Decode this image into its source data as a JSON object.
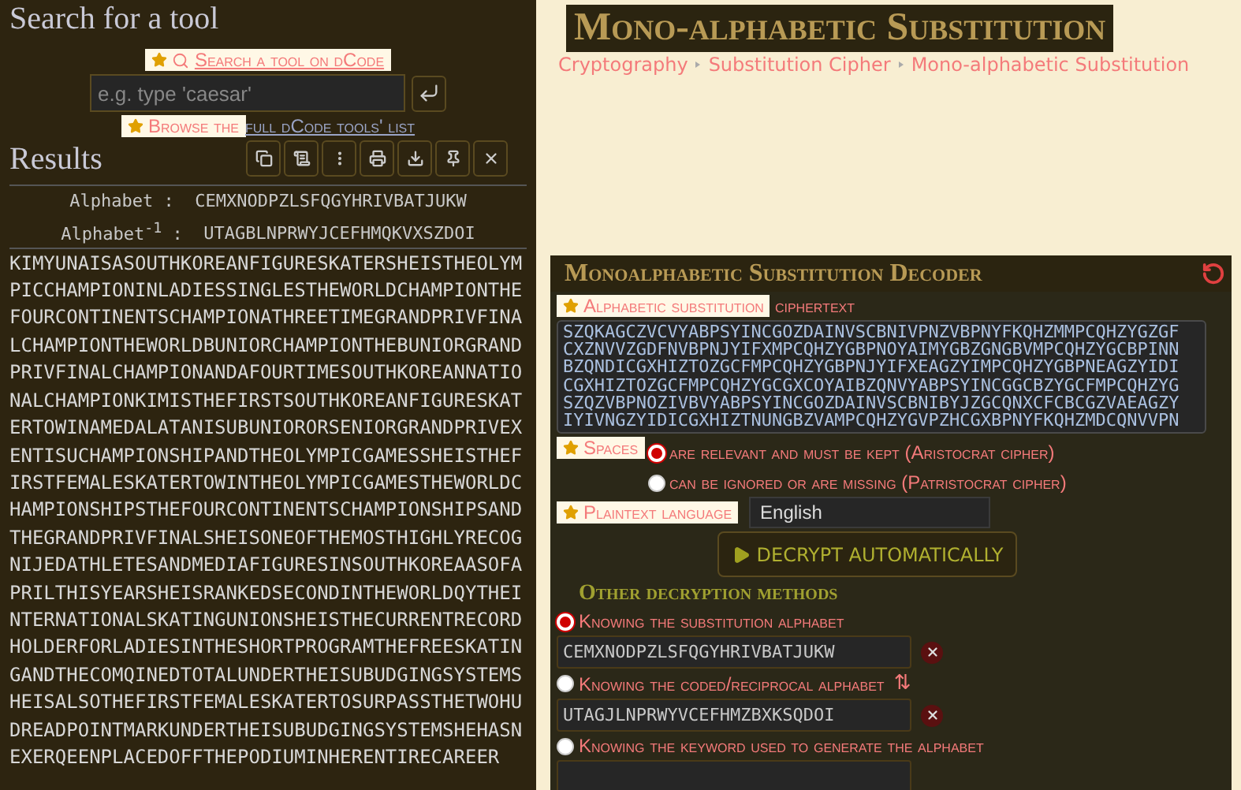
{
  "search_panel": {
    "title": "Search for a tool",
    "search_link": "Search a tool on dCode",
    "search_field": {
      "placeholder": "e.g. type 'caesar'"
    },
    "browse_prefix": "Browse the",
    "browse_link": "full dCode tools' list"
  },
  "results": {
    "title": "Results",
    "alphabet_label": "Alphabet :",
    "alphabet": "CEMXNODPZLSFQGYHRIVBATJUKW",
    "inverse_label": "Alphabet$^{-1}$ :",
    "inverse": "UTAGBLNPRWYJCEFHMQKVXSZDOI",
    "plaintext_lines": [
      "KIMYUNAISASOUTHKOREANFIGURESKATERSHEISTHEOLYM",
      "PICCHAMPIONINLADIESSINGLESTHEWORLDCHAMPIONTHE",
      "FOURCONTINENTSCHAMPIONATHREETIMEGRANDPRIVFINA",
      "LCHAMPIONTHEWORLDBUNIORCHAMPIONTHEBUNIORGRAND",
      "PRIVFINALCHAMPIONANDAFOURTIMESOUTHKOREANNATIO",
      "NALCHAMPIONKIMISTHEFIRSTSOUTHKOREANFIGURESKAT",
      "ERTOWINAMEDALATANISUBUNIORORSENIORGRANDPRIVEX",
      "ENTISUCHAMPIONSHIPANDTHEOLYMPICGAMESSHEISTHEF",
      "IRSTFEMALESKATERTOWINTHEOLYMPICGAMESTHEWORLDC",
      "HAMPIONSHIPSTHEFOURCONTINENTSCHAMPIONSHIPSAND",
      "THEGRANDPRIVFINALSHEISONEOFTHEMOSTHIGHLYRECOG",
      "NIJEDATHLETESANDMEDIAFIGURESINSOUTHKOREAASOFA",
      "PRILTHISYEARSHEISRANKEDSECONDINTHEWORLDQYTHEI",
      "NTERNATIONALSKATINGUNIONSHEISTHECURRENTRECORD",
      "HOLDERFORLADIESINTHESHORTPROGRAMTHEFREESKATIN",
      "GANDTHECOMQINEDTOTALUNDERTHEISUBUDGINGSYSTEMS",
      "HEISALSOTHEFIRSTFEMALESKATERTOSURPASSTHETWOHU",
      "DREADPOINTMARKUNDERTHEISUBUDGINGSYSTEMSHEHASN",
      "EXERQEENPLACEDOFFTHEPODIUMINHERENTIRECAREER"
    ]
  },
  "page": {
    "title": "Mono-alphabetic Substitution",
    "breadcrumbs": [
      "Cryptography",
      "Substitution Cipher",
      "Mono-alphabetic Substitution"
    ]
  },
  "decoder": {
    "title": "Monoalphabetic Substitution Decoder",
    "ciphertext_label": "Alphabetic substitution",
    "ciphertext_suffix": "ciphertext",
    "ciphertext_lines": [
      "SZQKAGCZVCVYABPSYINCGOZDAINVSCBNIVPNZVBPNYFKQHZMMPCQHZYGZGF",
      "CXZNVVZGDFNVBPNJYIFXMPCQHZYGBPNOYAIMYGBZGNGBVMPCQHZYGCBPINN",
      "BZQNDICGXHIZTOZGCFMPCQHZYGBPNJYIFXEAGZYIMPCQHZYGBPNEAGZYIDI",
      "CGXHIZTOZGCFMPCQHZYGCGXCOYAIBZQNVYABPSYINCGGCBZYGCFMPCQHZYG",
      "SZQZVBPNOZIVBVYABPSYINCGOZDAINVSCBNIBYJZGCQNXCFCBCGZVAEAGZY",
      "IYIVNGZYIDICGXHIZTNUNGBZVAMPCQHZYGVPZHCGXBPNYFKQHZMDCQNVVPN"
    ],
    "spaces_label": "Spaces",
    "spaces_options": [
      {
        "label": "are relevant and must be kept (Aristocrat cipher)",
        "selected": true
      },
      {
        "label": "can be ignored or are missing (Patristocrat cipher)",
        "selected": false
      }
    ],
    "language_label": "Plaintext language",
    "language": "English",
    "decrypt_button": "DECRYPT AUTOMATICALLY",
    "other_title": "Other decryption methods",
    "methods": [
      {
        "label": "Knowing the substitution alphabet",
        "selected": true,
        "value": "CEMXNODPZLSFQGYHRIVBATJUKW"
      },
      {
        "label": "Knowing the coded/reciprocal alphabet",
        "selected": false,
        "value": "UTAGJLNPRWYVCEFHMZBXKSQDOI",
        "symbol": "⇅"
      },
      {
        "label": "Knowing the keyword used to generate the alphabet",
        "selected": false
      }
    ]
  }
}
